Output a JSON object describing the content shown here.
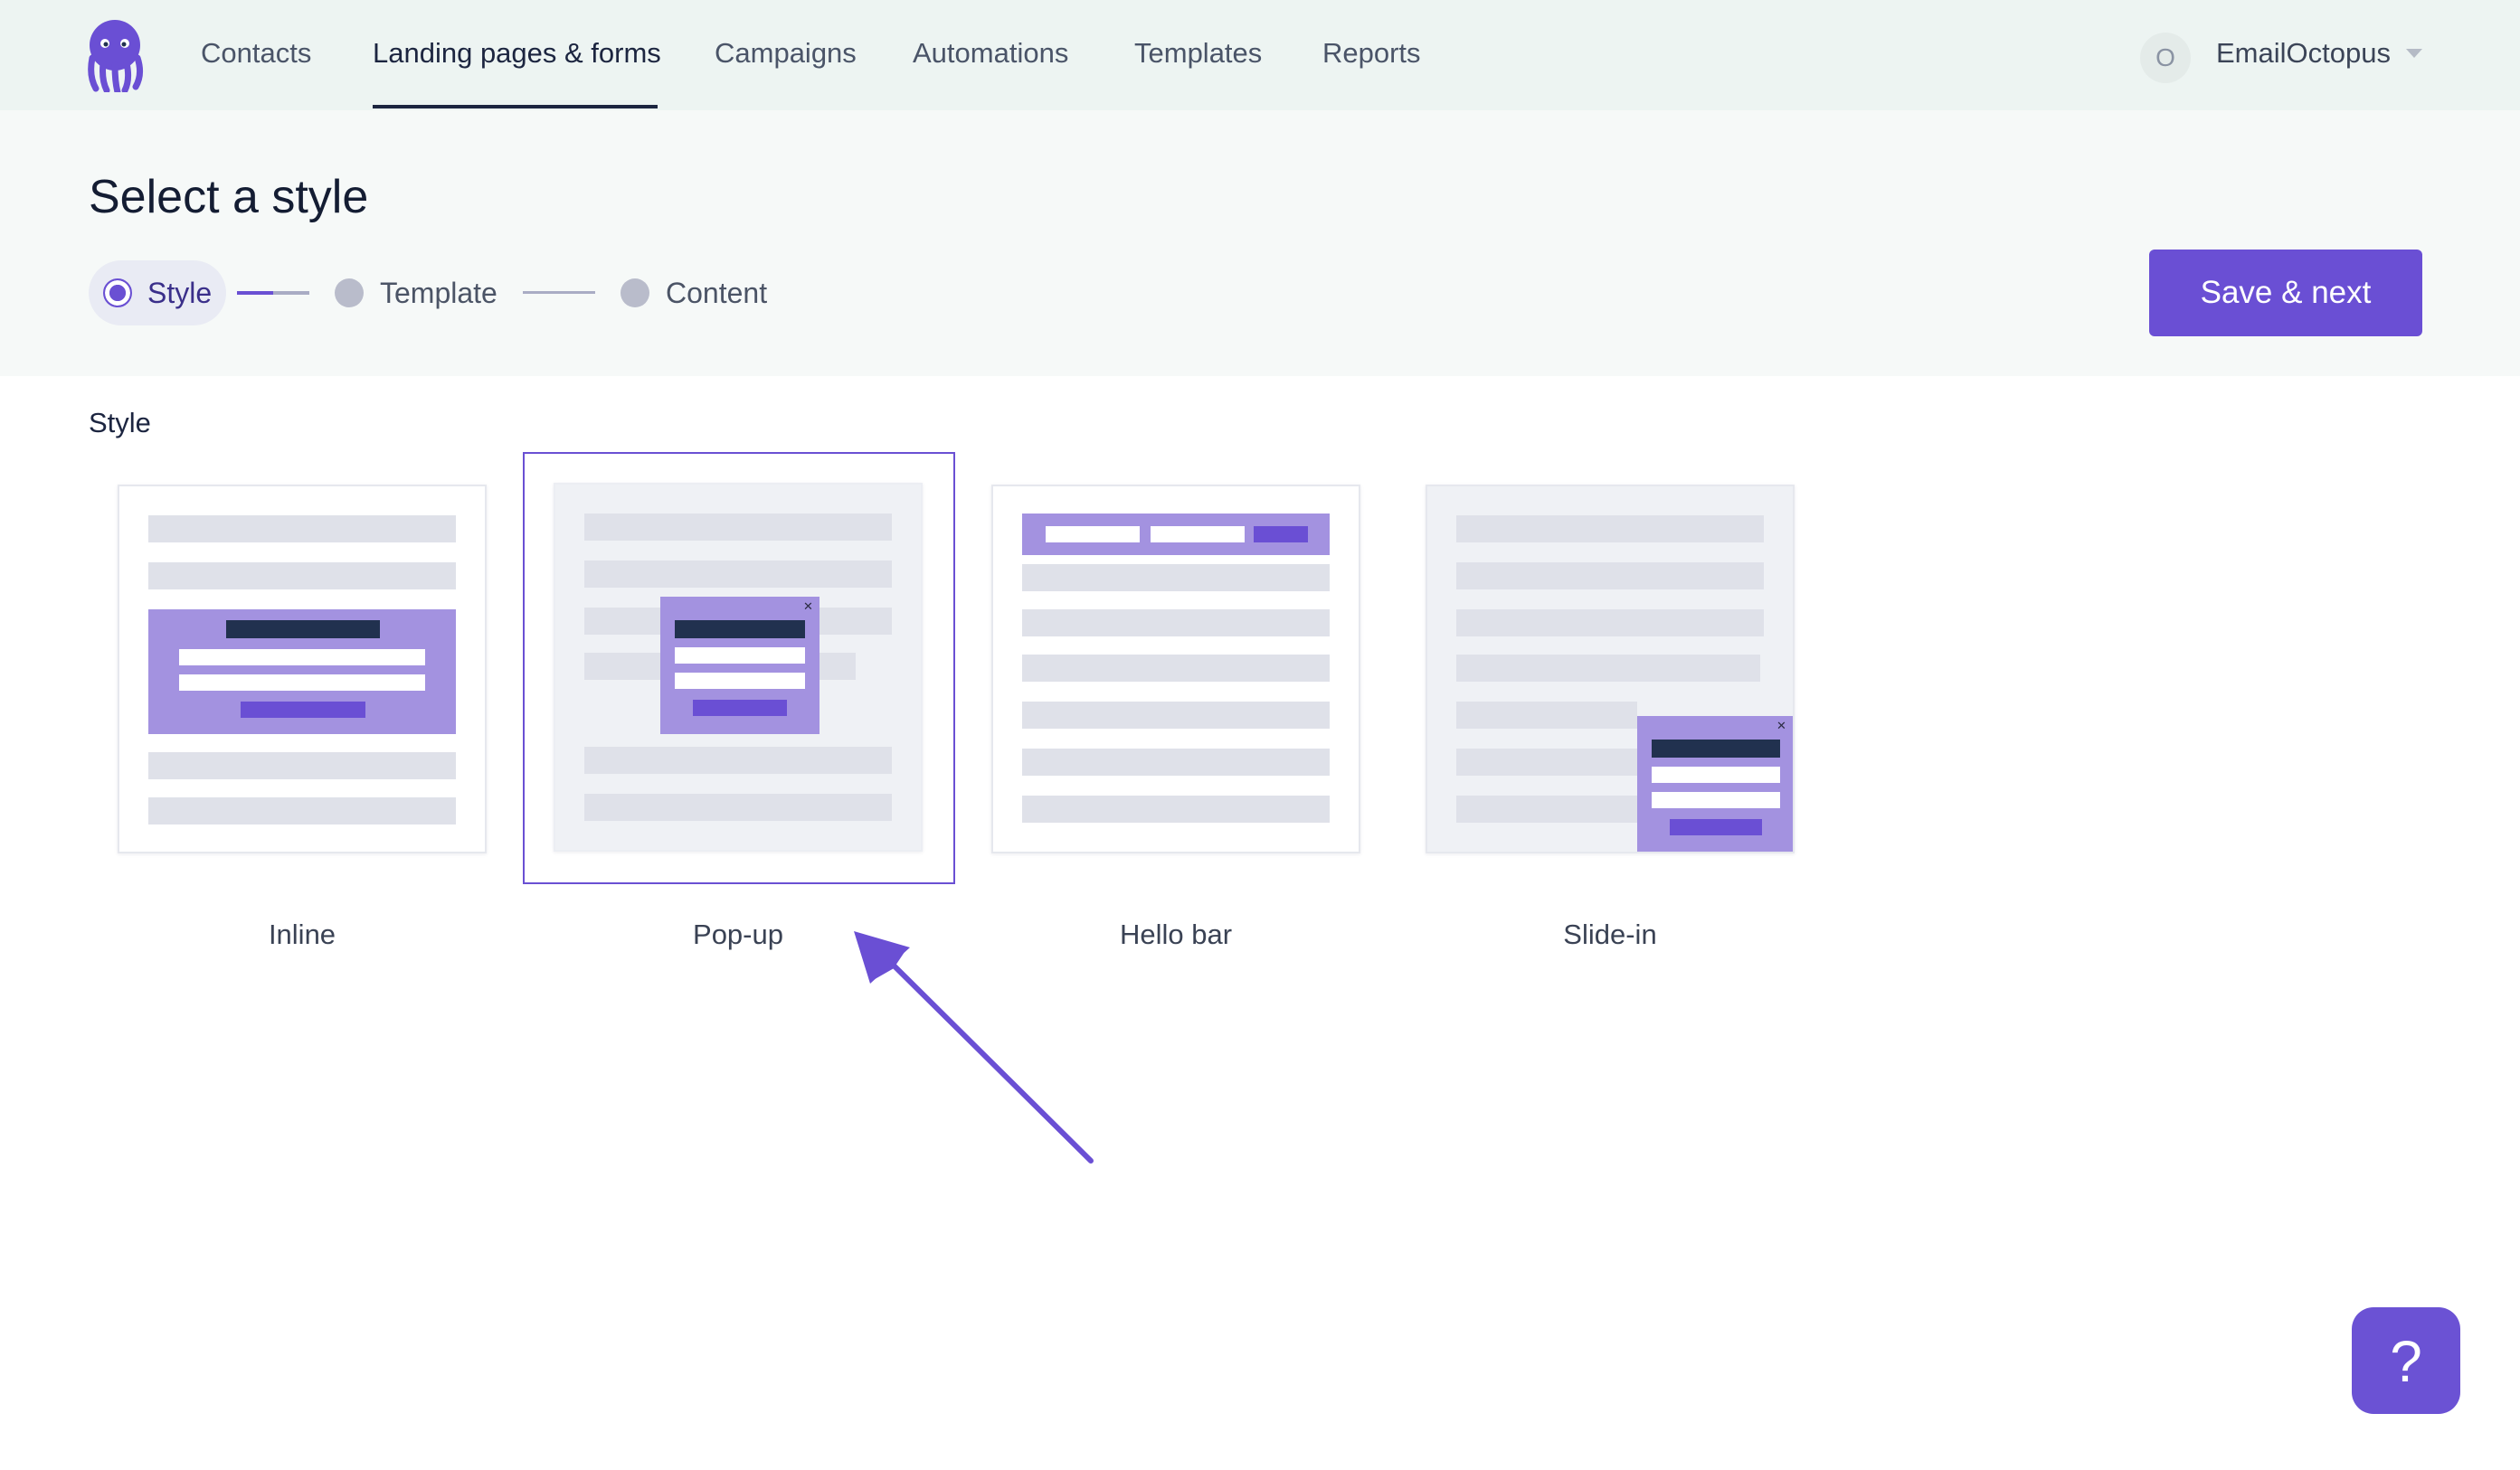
{
  "nav": {
    "items": [
      {
        "label": "Contacts"
      },
      {
        "label": "Landing pages & forms"
      },
      {
        "label": "Campaigns"
      },
      {
        "label": "Automations"
      },
      {
        "label": "Templates"
      },
      {
        "label": "Reports"
      }
    ],
    "active_index": 1,
    "account": {
      "avatar_initial": "O",
      "name": "EmailOctopus"
    }
  },
  "page": {
    "title": "Select a style"
  },
  "steps": [
    {
      "label": "Style",
      "state": "current"
    },
    {
      "label": "Template",
      "state": "pending"
    },
    {
      "label": "Content",
      "state": "pending"
    }
  ],
  "actions": {
    "save_next_label": "Save & next",
    "help_label": "?"
  },
  "section": {
    "label": "Style"
  },
  "styles": [
    {
      "label": "Inline",
      "selected": false
    },
    {
      "label": "Pop-up",
      "selected": true
    },
    {
      "label": "Hello bar",
      "selected": false
    },
    {
      "label": "Slide-in",
      "selected": false
    }
  ],
  "colors": {
    "accent": "#6a4fd4",
    "nav_bg": "#edf4f2",
    "preview_purple": "#a392e0",
    "preview_dark": "#21314f"
  },
  "icons": {
    "logo": "octopus-logo",
    "close": "close-icon",
    "arrow": "pointer-arrow"
  }
}
